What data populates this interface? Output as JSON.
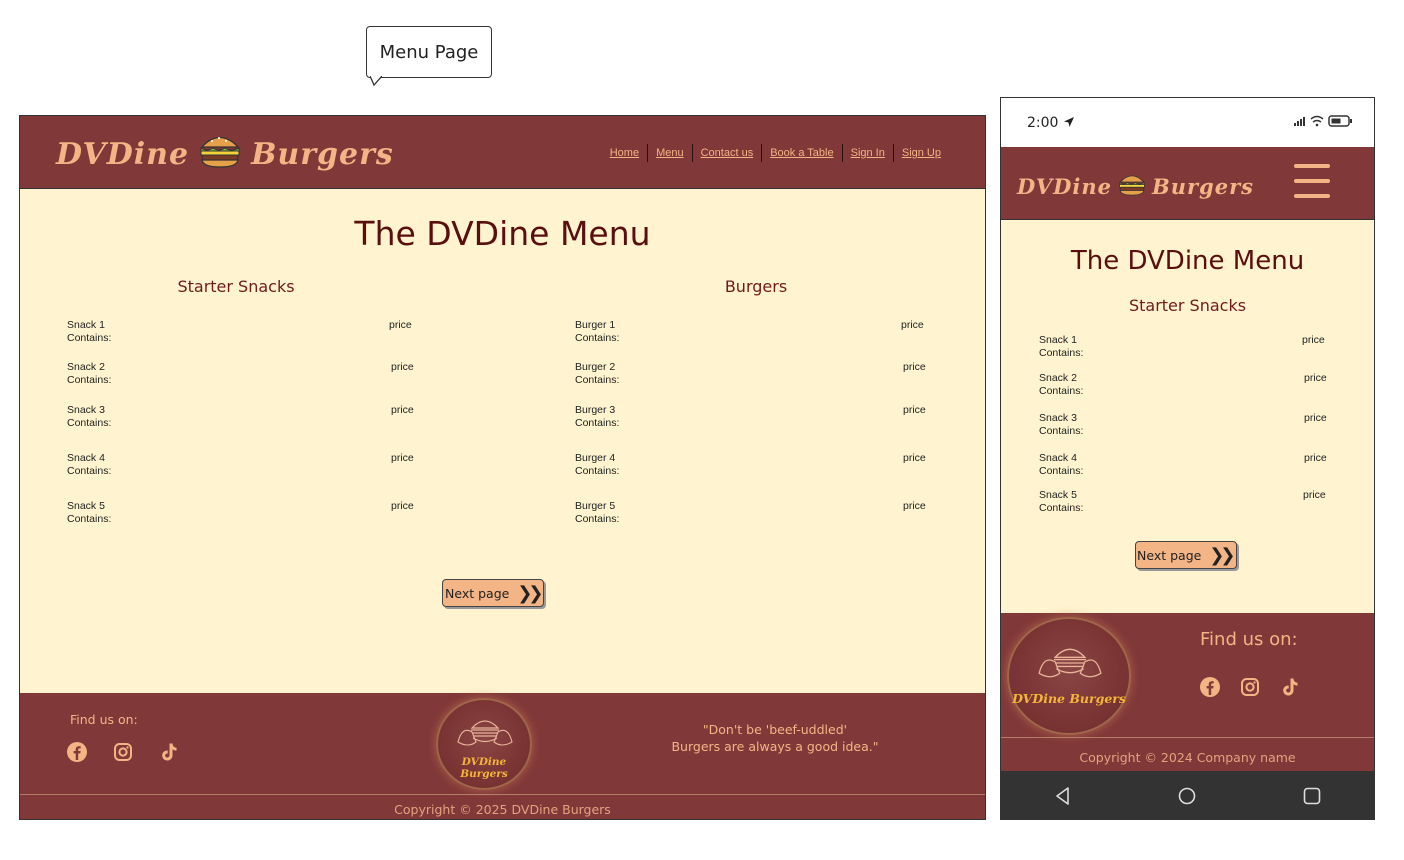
{
  "callout": {
    "label": "Menu Page"
  },
  "brand": {
    "name_part1": "DVDine",
    "name_part2": "Burgers",
    "emblem_text": "DVDine Burgers"
  },
  "desktop": {
    "nav": [
      "Home",
      "Menu",
      "Contact us",
      "Book a Table",
      "Sign In",
      "Sign Up"
    ],
    "title": "The DVDine Menu",
    "columns": [
      {
        "heading": "Starter Snacks",
        "items": [
          {
            "name": "Snack 1",
            "contains": "Contains:",
            "price": "price"
          },
          {
            "name": "Snack 2",
            "contains": "Contains:",
            "price": "price"
          },
          {
            "name": "Snack 3",
            "contains": "Contains:",
            "price": "price"
          },
          {
            "name": "Snack 4",
            "contains": "Contains:",
            "price": "price"
          },
          {
            "name": "Snack 5",
            "contains": "Contains:",
            "price": "price"
          }
        ]
      },
      {
        "heading": "Burgers",
        "items": [
          {
            "name": "Burger 1",
            "contains": "Contains:",
            "price": "price"
          },
          {
            "name": "Burger 2",
            "contains": "Contains:",
            "price": "price"
          },
          {
            "name": "Burger 3",
            "contains": "Contains:",
            "price": "price"
          },
          {
            "name": "Burger 4",
            "contains": "Contains:",
            "price": "price"
          },
          {
            "name": "Burger 5",
            "contains": "Contains:",
            "price": "price"
          }
        ]
      }
    ],
    "next_label": "Next page",
    "footer": {
      "find_us": "Find us on:",
      "quote_line1": "\"Don't be 'beef-uddled'",
      "quote_line2": "Burgers are always a good idea.\"",
      "copyright": "Copyright © 2025 DVDine Burgers"
    }
  },
  "mobile": {
    "time": "2:00",
    "title": "The DVDine Menu",
    "heading": "Starter Snacks",
    "items": [
      {
        "name": "Snack 1",
        "contains": "Contains:",
        "price": "price"
      },
      {
        "name": "Snack 2",
        "contains": "Contains:",
        "price": "price"
      },
      {
        "name": "Snack 3",
        "contains": "Contains:",
        "price": "price"
      },
      {
        "name": "Snack 4",
        "contains": "Contains:",
        "price": "price"
      },
      {
        "name": "Snack 5",
        "contains": "Contains:",
        "price": "price"
      }
    ],
    "next_label": "Next page",
    "footer": {
      "find_us": "Find us on:",
      "copyright": "Copyright © 2024 Company name"
    }
  },
  "icons": [
    "facebook-icon",
    "instagram-icon",
    "tiktok-icon",
    "hamburger-menu-icon",
    "back-icon",
    "home-icon",
    "recents-icon"
  ],
  "colors": {
    "header": "#813838",
    "accent": "#f3b586",
    "page": "#fff4cf",
    "title": "#5a0f0f"
  }
}
